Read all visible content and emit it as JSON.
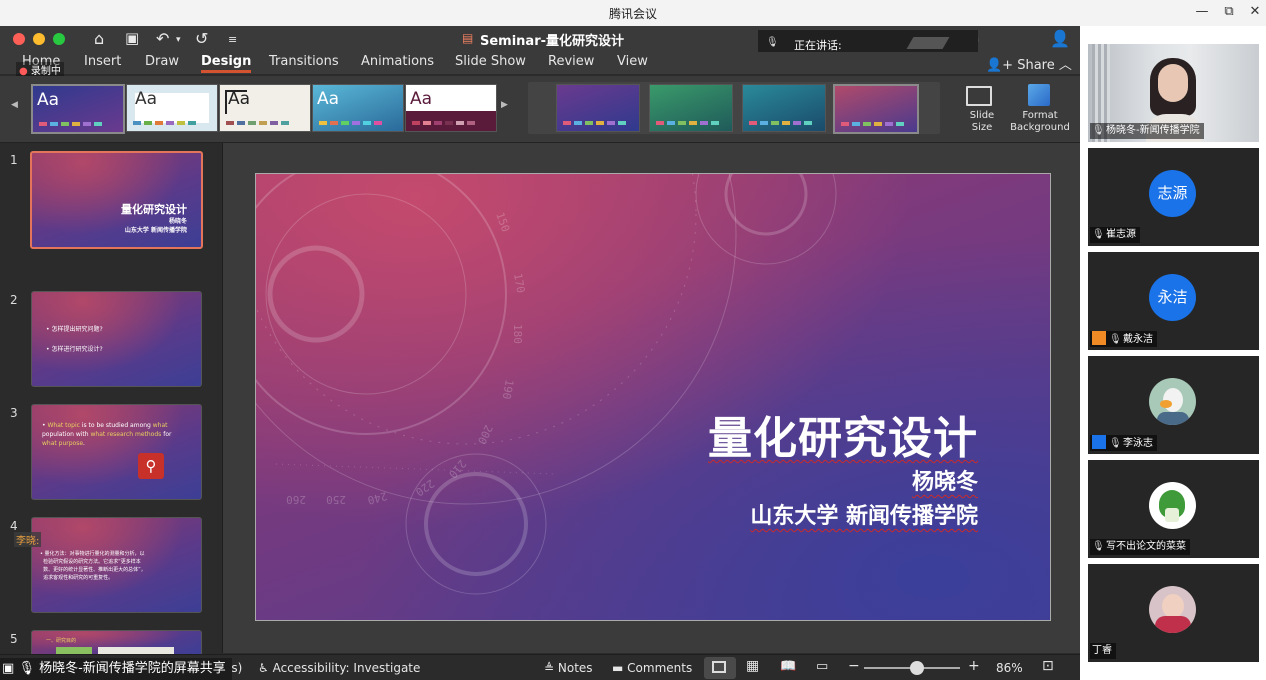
{
  "window": {
    "title": "腾讯会议",
    "minimize": "—",
    "restore": "⧉",
    "close": "✕"
  },
  "recording": {
    "label": "录制中"
  },
  "powerpoint": {
    "document_title": "Seminar-量化研究设计",
    "speaking_label": "正在讲话:",
    "tabs": [
      "Home",
      "Insert",
      "Draw",
      "Design",
      "Transitions",
      "Animations",
      "Slide Show",
      "Review",
      "View"
    ],
    "active_tab": "Design",
    "share_label": "Share",
    "tell_me_partial": "tion",
    "themes": [
      {
        "label": "Aa",
        "text_color": "#ffffff"
      },
      {
        "label": "Aa",
        "text_color": "#333333"
      },
      {
        "label": "Aa",
        "text_color": "#222222"
      },
      {
        "label": "Aa",
        "text_color": "#ffffff"
      },
      {
        "label": "Aa",
        "text_color": "#5a1a3a"
      }
    ],
    "slide_size_label": [
      "Slide",
      "Size"
    ],
    "format_background_label": [
      "Format",
      "Background"
    ]
  },
  "slides": [
    {
      "number": "1",
      "title": "量化研究设计",
      "sub1": "杨晓冬",
      "sub2": "山东大学  新闻传播学院"
    },
    {
      "number": "2",
      "bullets": [
        "• 怎样提出研究问题?",
        "• 怎样进行研究设计?"
      ]
    },
    {
      "number": "3",
      "parts": [
        "• ",
        "What topic",
        " is to be studied among ",
        "what",
        " population",
        " with ",
        "what research methods",
        " for ",
        "what purpose",
        "."
      ]
    },
    {
      "number": "4",
      "bullets": [
        "• 量化方法：对事物进行量化的测量和分析，以",
        "  检验研究假设的研究方法。它追求“更多样本",
        "  数、更好的统计显著性、推断出更大的总体”，",
        "  追求客观性和研究的可重复性。"
      ]
    },
    {
      "number": "5",
      "heading": "一、研究目的"
    }
  ],
  "main_slide": {
    "title": "量化研究设计",
    "author": "杨晓冬",
    "affiliation": "山东大学  新闻传播学院"
  },
  "hover_name": "李晓:",
  "status_bar": {
    "partial": "es)",
    "accessibility": "Accessibility: Investigate",
    "notes": "Notes",
    "comments": "Comments",
    "zoom_minus": "−",
    "zoom_plus": "+",
    "zoom": "86%",
    "zoom_level": 0.55
  },
  "share_banner": "杨晓冬-新闻传播学院的屏幕共享",
  "participants": [
    {
      "name": "杨晓冬-新闻传播学院",
      "avatar_text": "",
      "avatar_kind": "video"
    },
    {
      "name": "崔志源",
      "avatar_text": "志源",
      "avatar_kind": "blue"
    },
    {
      "name": "戴永洁",
      "avatar_text": "永洁",
      "avatar_kind": "blue"
    },
    {
      "name": "李泳志",
      "avatar_text": "",
      "avatar_kind": "duck"
    },
    {
      "name": "写不出论文的菜菜",
      "avatar_text": "",
      "avatar_kind": "cabbage"
    },
    {
      "name": "丁睿",
      "avatar_text": "",
      "avatar_kind": "baby"
    }
  ],
  "colors": {
    "accent": "#d35230",
    "meeting_blue": "#1a73e8",
    "squiggle": "#cc2a2a"
  }
}
